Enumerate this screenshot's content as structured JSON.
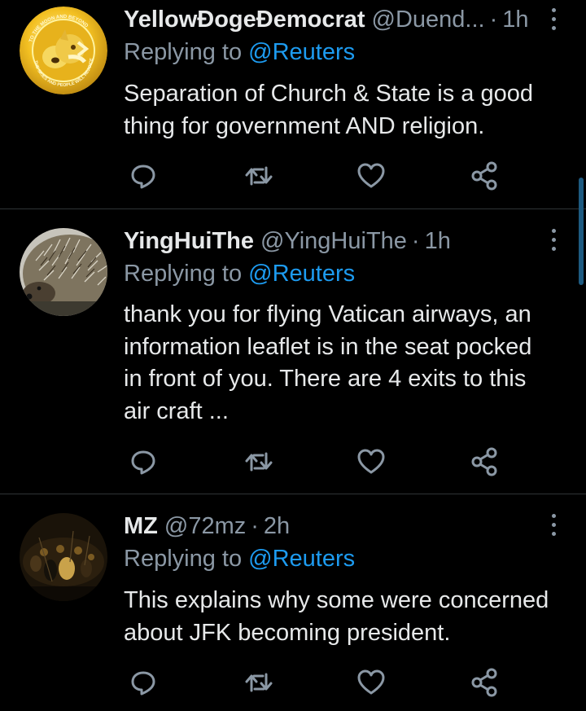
{
  "tweets": [
    {
      "name": "YellowĐogeĐemocrat",
      "handle": "@Duend...",
      "dot": "·",
      "time": "1h",
      "reply_prefix": "Replying to",
      "reply_to": "@Reuters",
      "text": "Separation of Church & State is a good\nthing for government AND religion.",
      "avatar": "doge-coin-avatar",
      "avatar_text": "TO THE MOON AND BEYOND · THE SKIES AND PEOPLE WILL REJOICE"
    },
    {
      "name": "YingHuiThe",
      "handle": "@YingHuiThe",
      "dot": "·",
      "time": "1h",
      "reply_prefix": "Replying to",
      "reply_to": "@Reuters",
      "text": "thank you for flying Vatican airways, an\ninformation leaflet is in the seat pocked\nin front of you. There are 4 exits to this\nair craft ...",
      "avatar": "hedgehog-avatar"
    },
    {
      "name": "MZ",
      "handle": "@72mz",
      "dot": "·",
      "time": "2h",
      "reply_prefix": "Replying to",
      "reply_to": "@Reuters",
      "text": "This explains why some were concerned\nabout JFK becoming president.",
      "avatar": "painting-avatar"
    }
  ],
  "actions": [
    "reply-icon",
    "retweet-icon",
    "like-icon",
    "share-icon"
  ],
  "colors": {
    "background": "#000000",
    "link": "#1d9bf0",
    "muted": "#8b98a5",
    "divider": "#2f3336"
  }
}
